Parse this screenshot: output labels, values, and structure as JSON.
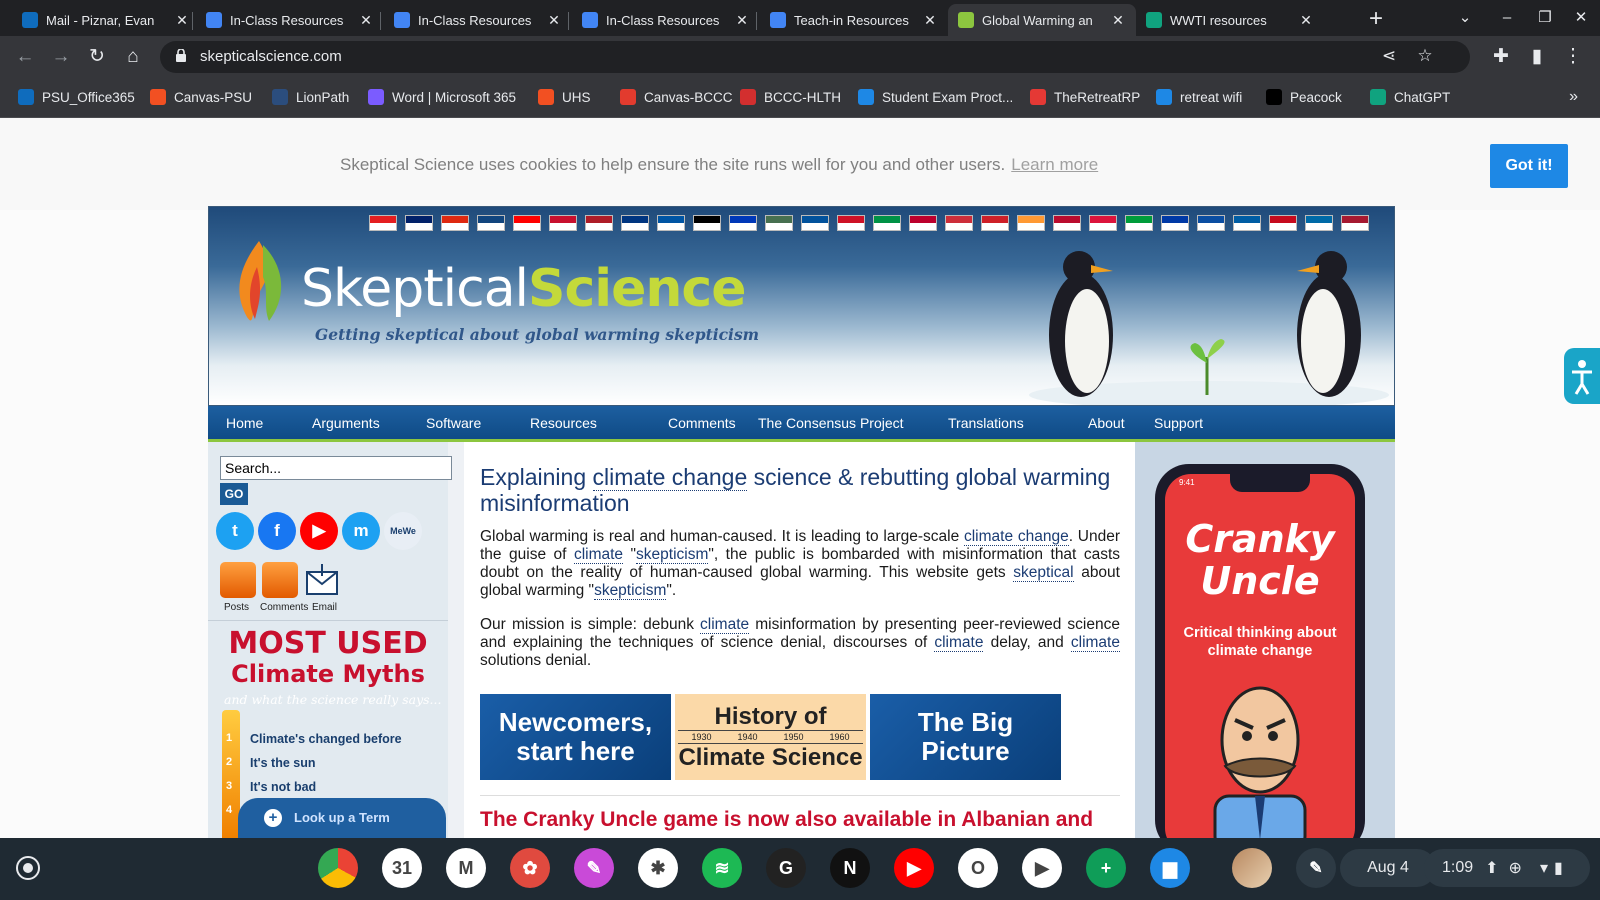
{
  "browser": {
    "tabs": [
      {
        "label": "Mail - Piznar, Evan",
        "icon": "outlook-icon",
        "color": "#0f6cbd",
        "active": false
      },
      {
        "label": "In-Class Resources",
        "icon": "docs-icon",
        "color": "#4285f4",
        "active": false
      },
      {
        "label": "In-Class Resources",
        "icon": "docs-icon",
        "color": "#4285f4",
        "active": false
      },
      {
        "label": "In-Class Resources",
        "icon": "docs-icon",
        "color": "#4285f4",
        "active": false
      },
      {
        "label": "Teach-in Resources",
        "icon": "docs-icon",
        "color": "#4285f4",
        "active": false
      },
      {
        "label": "Global Warming an",
        "icon": "skepticalscience-icon",
        "color": "#8cc63f",
        "active": true
      },
      {
        "label": "WWTI resources",
        "icon": "chatgpt-icon",
        "color": "#10a37f",
        "active": false
      }
    ],
    "url": "skepticalscience.com",
    "bookmarks": [
      {
        "label": "PSU_Office365",
        "color": "#0f6cbd"
      },
      {
        "label": "Canvas-PSU",
        "color": "#f25022"
      },
      {
        "label": "LionPath",
        "color": "#2b4d7d"
      },
      {
        "label": "Word | Microsoft 365",
        "color": "#7b5cff"
      },
      {
        "label": "UHS",
        "color": "#f25022"
      },
      {
        "label": "Canvas-BCCC",
        "color": "#e23b2e"
      },
      {
        "label": "BCCC-HLTH",
        "color": "#d32f2f"
      },
      {
        "label": "Student Exam Proct...",
        "color": "#1e88e5"
      },
      {
        "label": "TheRetreatRP",
        "color": "#e53935"
      },
      {
        "label": "retreat wifi",
        "color": "#1e88e5"
      },
      {
        "label": "Peacock",
        "color": "#000000"
      },
      {
        "label": "ChatGPT",
        "color": "#10a37f"
      }
    ]
  },
  "cookie": {
    "message": "Skeptical Science uses cookies to help ensure the site runs well for you and other users.",
    "learn_more": "Learn more",
    "button": "Got it!"
  },
  "site": {
    "logo_word1": "Skeptical",
    "logo_word2": "Science",
    "tagline": "Getting skeptical about global warming skepticism",
    "nav": [
      "Home",
      "Arguments",
      "Software",
      "Resources",
      "Comments",
      "The Consensus Project",
      "Translations",
      "About",
      "Support"
    ],
    "search_value": "Search...",
    "go_label": "GO",
    "social": [
      {
        "name": "twitter-icon",
        "glyph": "t",
        "color": "#1da1f2"
      },
      {
        "name": "facebook-icon",
        "glyph": "f",
        "color": "#1877f2"
      },
      {
        "name": "youtube-icon",
        "glyph": "▶",
        "color": "#ff0000"
      },
      {
        "name": "mastodon-icon",
        "glyph": "m",
        "color": "#1da1f2"
      },
      {
        "name": "mewe-icon",
        "glyph": "MeWe",
        "color": "#e8eef5"
      }
    ],
    "feeds": [
      "Posts",
      "Comments",
      "Email"
    ],
    "myths_title": "MOST USED",
    "myths_sub": "Climate Myths",
    "myths_note": "and what the science really says...",
    "myths": [
      "Climate's changed before",
      "It's the sun",
      "It's not bad"
    ],
    "lookup_label": "Look up a Term",
    "heading_parts": [
      "Explaining ",
      "climate change",
      " science & rebutting global warming misinformation"
    ],
    "para1": [
      {
        "t": "Global warming is real and human-caused. It is leading to large-scale "
      },
      {
        "k": "climate change"
      },
      {
        "t": ". Under the guise of "
      },
      {
        "k": "climate"
      },
      {
        "t": " \""
      },
      {
        "k": "skepticism"
      },
      {
        "t": "\", the public is bombarded with misinformation that casts doubt on the reality of human-caused global warming. This website gets "
      },
      {
        "k": "skeptical"
      },
      {
        "t": " about global warming \""
      },
      {
        "k": "skepticism"
      },
      {
        "t": "\"."
      }
    ],
    "para2": [
      {
        "t": "Our mission is simple: debunk "
      },
      {
        "k": "climate"
      },
      {
        "t": " misinformation by presenting peer-reviewed science and explaining the techniques of science denial, discourses of "
      },
      {
        "k": "climate"
      },
      {
        "t": " delay, and "
      },
      {
        "k": "climate"
      },
      {
        "t": " solutions denial."
      }
    ],
    "promos": [
      {
        "line1": "Newcomers,",
        "line2": "start here",
        "style": "blue"
      },
      {
        "line1": "History of",
        "line2": "Climate Science",
        "style": "tan",
        "years": [
          "1930",
          "1940",
          "1950",
          "1960"
        ]
      },
      {
        "line1": "The Big",
        "line2": "Picture",
        "style": "blue"
      }
    ],
    "red_heading": "The Cranky Uncle game is now also available in Albanian and",
    "cranky_title1": "Cranky",
    "cranky_title2": "Uncle",
    "cranky_sub": "Critical thinking about climate change",
    "phone_time": "9:41"
  },
  "shelf": {
    "apps": [
      {
        "name": "chrome-icon",
        "color": "#ffffff",
        "glyph": ""
      },
      {
        "name": "calendar-icon",
        "color": "#ffffff",
        "glyph": "31"
      },
      {
        "name": "gmail-icon",
        "color": "#ffffff",
        "glyph": "M"
      },
      {
        "name": "canvas-icon",
        "color": "#e04a3f",
        "glyph": "✿"
      },
      {
        "name": "sketch-icon",
        "color": "#c94ad8",
        "glyph": "✎"
      },
      {
        "name": "photos-icon",
        "color": "#ffffff",
        "glyph": "✱"
      },
      {
        "name": "spotify-icon",
        "color": "#1db954",
        "glyph": "≋"
      },
      {
        "name": "grammarly-icon",
        "color": "#222222",
        "glyph": "G"
      },
      {
        "name": "netflix-icon",
        "color": "#111111",
        "glyph": "N"
      },
      {
        "name": "youtube-app-icon",
        "color": "#ff0000",
        "glyph": "▶"
      },
      {
        "name": "office-icon",
        "color": "#ffffff",
        "glyph": "O"
      },
      {
        "name": "play-store-icon",
        "color": "#ffffff",
        "glyph": "▶"
      },
      {
        "name": "sheets-icon",
        "color": "#0f9d58",
        "glyph": "+"
      },
      {
        "name": "files-icon",
        "color": "#1e88e5",
        "glyph": "▆"
      }
    ],
    "date": "Aug 4",
    "time": "1:09"
  }
}
